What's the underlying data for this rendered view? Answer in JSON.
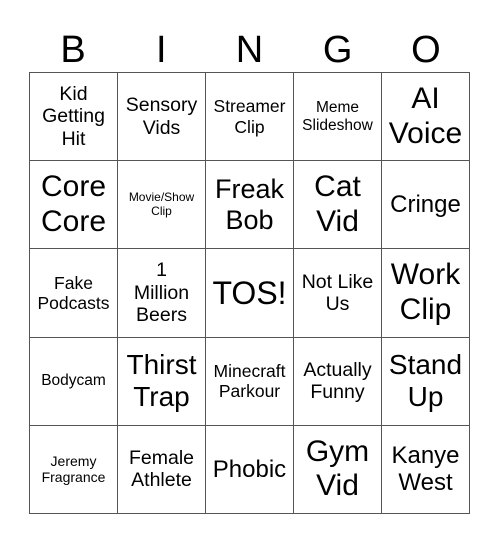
{
  "header": [
    "B",
    "I",
    "N",
    "G",
    "O"
  ],
  "cells": [
    [
      "Kid Getting Hit",
      "Sensory Vids",
      "Streamer Clip",
      "Meme Slideshow",
      "AI Voice"
    ],
    [
      "Core Core",
      "Movie/Show Clip",
      "Freak Bob",
      "Cat Vid",
      "Cringe"
    ],
    [
      "Fake Podcasts",
      "1 Million Beers",
      "TOS!",
      "Not Like Us",
      "Work Clip"
    ],
    [
      "Bodycam",
      "Thirst Trap",
      "Minecraft Parkour",
      "Actually Funny",
      "Stand Up"
    ],
    [
      "Jeremy Fragrance",
      "Female Athlete",
      "Phobic",
      "Gym Vid",
      "Kanye West"
    ]
  ]
}
